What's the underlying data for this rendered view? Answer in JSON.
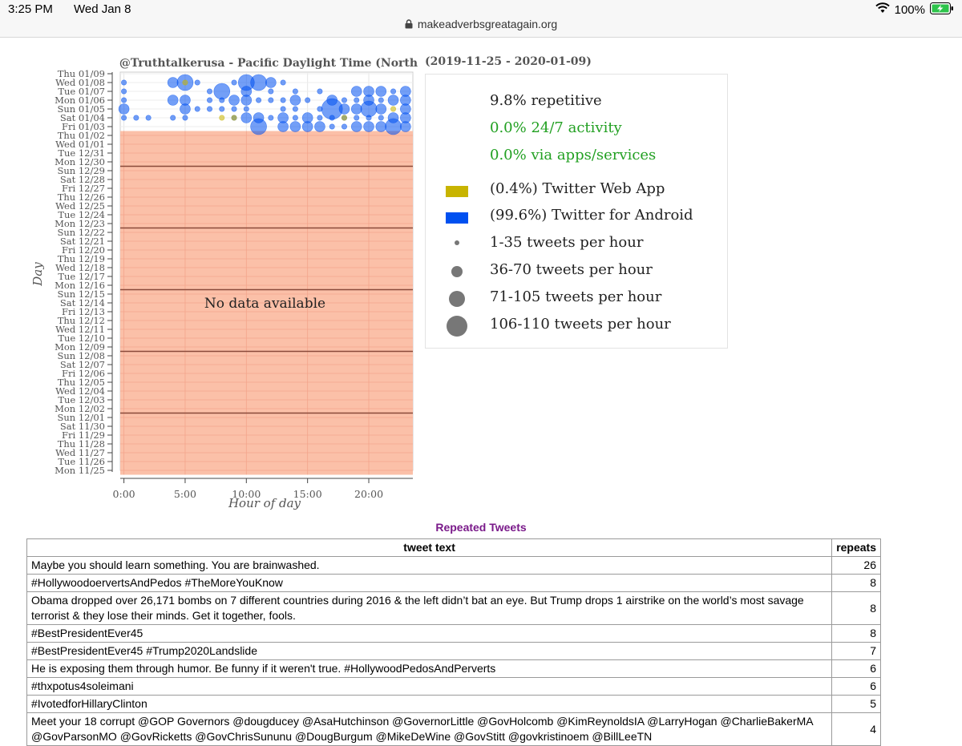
{
  "status_bar": {
    "time": "3:25 PM",
    "day": "Wed Jan 8",
    "battery": "100%",
    "url": "makeadverbsgreatagain.org"
  },
  "colors": {
    "no_data": "#fbc0a8",
    "android": "#0050f0",
    "web_app": "#c8b400",
    "green_text": "#22a022",
    "title_purple": "#7a1a8a"
  },
  "chart_data": {
    "type": "scatter",
    "title": "@Truthtalkerusa - Pacific Daylight Time (North",
    "subtitle": "(2019-11-25 - 2020-01-09)",
    "xlabel": "Hour of day",
    "ylabel": "Day",
    "x_ticks": [
      "0:00",
      "5:00",
      "10:00",
      "15:00",
      "20:00"
    ],
    "x_tick_values": [
      0,
      5,
      10,
      15,
      20
    ],
    "xlim": [
      -0.3,
      23.6
    ],
    "no_data_label": "No data available",
    "no_data_days": [
      "Mon 11/25",
      "Thu 01/02"
    ],
    "y_categories": [
      "Thu 01/09",
      "Wed 01/08",
      "Tue 01/07",
      "Mon 01/06",
      "Sun 01/05",
      "Sat 01/04",
      "Fri 01/03",
      "Thu 01/02",
      "Wed 01/01",
      "Tue 12/31",
      "Mon 12/30",
      "Sun 12/29",
      "Sat 12/28",
      "Fri 12/27",
      "Thu 12/26",
      "Wed 12/25",
      "Tue 12/24",
      "Mon 12/23",
      "Sun 12/22",
      "Sat 12/21",
      "Fri 12/20",
      "Thu 12/19",
      "Wed 12/18",
      "Tue 12/17",
      "Mon 12/16",
      "Sun 12/15",
      "Sat 12/14",
      "Fri 12/13",
      "Thu 12/12",
      "Wed 12/11",
      "Tue 12/10",
      "Mon 12/09",
      "Sun 12/08",
      "Sat 12/07",
      "Fri 12/06",
      "Thu 12/05",
      "Wed 12/04",
      "Tue 12/03",
      "Mon 12/02",
      "Sun 12/01",
      "Sat 11/30",
      "Fri 11/29",
      "Thu 11/28",
      "Wed 11/27",
      "Tue 11/26",
      "Mon 11/25"
    ],
    "week_lines": [
      "Mon 12/30",
      "Mon 12/23",
      "Mon 12/16",
      "Mon 12/09",
      "Mon 12/02"
    ],
    "series": [
      {
        "name": "Twitter for Android",
        "color": "#0050f0",
        "points": [
          {
            "day": "Wed 01/08",
            "hour": 0,
            "size": 1
          },
          {
            "day": "Tue 01/07",
            "hour": 0,
            "size": 1
          },
          {
            "day": "Mon 01/06",
            "hour": 0,
            "size": 1
          },
          {
            "day": "Sun 01/05",
            "hour": 0,
            "size": 2
          },
          {
            "day": "Sat 01/04",
            "hour": 0,
            "size": 1
          },
          {
            "day": "Sat 01/04",
            "hour": 1,
            "size": 1
          },
          {
            "day": "Sat 01/04",
            "hour": 2,
            "size": 1
          },
          {
            "day": "Wed 01/08",
            "hour": 4,
            "size": 2
          },
          {
            "day": "Mon 01/06",
            "hour": 4,
            "size": 2
          },
          {
            "day": "Sat 01/04",
            "hour": 4,
            "size": 1
          },
          {
            "day": "Wed 01/08",
            "hour": 5,
            "size": 3
          },
          {
            "day": "Mon 01/06",
            "hour": 5,
            "size": 2
          },
          {
            "day": "Sun 01/05",
            "hour": 5,
            "size": 2
          },
          {
            "day": "Sat 01/04",
            "hour": 5,
            "size": 1
          },
          {
            "day": "Wed 01/08",
            "hour": 6,
            "size": 1
          },
          {
            "day": "Sun 01/05",
            "hour": 6,
            "size": 1
          },
          {
            "day": "Tue 01/07",
            "hour": 7,
            "size": 1
          },
          {
            "day": "Mon 01/06",
            "hour": 7,
            "size": 1
          },
          {
            "day": "Sun 01/05",
            "hour": 7,
            "size": 1
          },
          {
            "day": "Tue 01/07",
            "hour": 8,
            "size": 3
          },
          {
            "day": "Mon 01/06",
            "hour": 8,
            "size": 1
          },
          {
            "day": "Sun 01/05",
            "hour": 8,
            "size": 1
          },
          {
            "day": "Wed 01/08",
            "hour": 9,
            "size": 1
          },
          {
            "day": "Mon 01/06",
            "hour": 9,
            "size": 2
          },
          {
            "day": "Sun 01/05",
            "hour": 9,
            "size": 1
          },
          {
            "day": "Sat 01/04",
            "hour": 9,
            "size": 1
          },
          {
            "day": "Wed 01/08",
            "hour": 10,
            "size": 3
          },
          {
            "day": "Tue 01/07",
            "hour": 10,
            "size": 2
          },
          {
            "day": "Mon 01/06",
            "hour": 10,
            "size": 2
          },
          {
            "day": "Sun 01/05",
            "hour": 10,
            "size": 1
          },
          {
            "day": "Sat 01/04",
            "hour": 10,
            "size": 2
          },
          {
            "day": "Wed 01/08",
            "hour": 11,
            "size": 3
          },
          {
            "day": "Mon 01/06",
            "hour": 11,
            "size": 1
          },
          {
            "day": "Sat 01/04",
            "hour": 11,
            "size": 2
          },
          {
            "day": "Fri 01/03",
            "hour": 11,
            "size": 3
          },
          {
            "day": "Wed 01/08",
            "hour": 12,
            "size": 2
          },
          {
            "day": "Tue 01/07",
            "hour": 12,
            "size": 1
          },
          {
            "day": "Mon 01/06",
            "hour": 12,
            "size": 1
          },
          {
            "day": "Sat 01/04",
            "hour": 12,
            "size": 1
          },
          {
            "day": "Wed 01/08",
            "hour": 13,
            "size": 1
          },
          {
            "day": "Mon 01/06",
            "hour": 13,
            "size": 1
          },
          {
            "day": "Sun 01/05",
            "hour": 13,
            "size": 1
          },
          {
            "day": "Sat 01/04",
            "hour": 13,
            "size": 2
          },
          {
            "day": "Fri 01/03",
            "hour": 13,
            "size": 2
          },
          {
            "day": "Tue 01/07",
            "hour": 14,
            "size": 1
          },
          {
            "day": "Mon 01/06",
            "hour": 14,
            "size": 2
          },
          {
            "day": "Sun 01/05",
            "hour": 14,
            "size": 1
          },
          {
            "day": "Sat 01/04",
            "hour": 14,
            "size": 1
          },
          {
            "day": "Fri 01/03",
            "hour": 14,
            "size": 2
          },
          {
            "day": "Mon 01/06",
            "hour": 15,
            "size": 1
          },
          {
            "day": "Sat 01/04",
            "hour": 15,
            "size": 2
          },
          {
            "day": "Fri 01/03",
            "hour": 15,
            "size": 2
          },
          {
            "day": "Tue 01/07",
            "hour": 16,
            "size": 1
          },
          {
            "day": "Sun 01/05",
            "hour": 16,
            "size": 1
          },
          {
            "day": "Sat 01/04",
            "hour": 16,
            "size": 1
          },
          {
            "day": "Fri 01/03",
            "hour": 16,
            "size": 2
          },
          {
            "day": "Mon 01/06",
            "hour": 17,
            "size": 2
          },
          {
            "day": "Sun 01/05",
            "hour": 17,
            "size": 4
          },
          {
            "day": "Sat 01/04",
            "hour": 17,
            "size": 1
          },
          {
            "day": "Fri 01/03",
            "hour": 17,
            "size": 1
          },
          {
            "day": "Mon 01/06",
            "hour": 18,
            "size": 1
          },
          {
            "day": "Sun 01/05",
            "hour": 18,
            "size": 2
          },
          {
            "day": "Sat 01/04",
            "hour": 18,
            "size": 1
          },
          {
            "day": "Fri 01/03",
            "hour": 18,
            "size": 1
          },
          {
            "day": "Tue 01/07",
            "hour": 19,
            "size": 2
          },
          {
            "day": "Mon 01/06",
            "hour": 19,
            "size": 1
          },
          {
            "day": "Sun 01/05",
            "hour": 19,
            "size": 2
          },
          {
            "day": "Sat 01/04",
            "hour": 19,
            "size": 1
          },
          {
            "day": "Fri 01/03",
            "hour": 19,
            "size": 2
          },
          {
            "day": "Tue 01/07",
            "hour": 20,
            "size": 2
          },
          {
            "day": "Mon 01/06",
            "hour": 20,
            "size": 2
          },
          {
            "day": "Sun 01/05",
            "hour": 20,
            "size": 3
          },
          {
            "day": "Sat 01/04",
            "hour": 20,
            "size": 1
          },
          {
            "day": "Fri 01/03",
            "hour": 20,
            "size": 2
          },
          {
            "day": "Tue 01/07",
            "hour": 21,
            "size": 2
          },
          {
            "day": "Mon 01/06",
            "hour": 21,
            "size": 1
          },
          {
            "day": "Sun 01/05",
            "hour": 21,
            "size": 2
          },
          {
            "day": "Sat 01/04",
            "hour": 21,
            "size": 1
          },
          {
            "day": "Fri 01/03",
            "hour": 21,
            "size": 2
          },
          {
            "day": "Tue 01/07",
            "hour": 22,
            "size": 1
          },
          {
            "day": "Mon 01/06",
            "hour": 22,
            "size": 2
          },
          {
            "day": "Sat 01/04",
            "hour": 22,
            "size": 2
          },
          {
            "day": "Fri 01/03",
            "hour": 22,
            "size": 3
          },
          {
            "day": "Tue 01/07",
            "hour": 23,
            "size": 2
          },
          {
            "day": "Mon 01/06",
            "hour": 23,
            "size": 2
          },
          {
            "day": "Sun 01/05",
            "hour": 23,
            "size": 2
          },
          {
            "day": "Sat 01/04",
            "hour": 23,
            "size": 2
          },
          {
            "day": "Fri 01/03",
            "hour": 23,
            "size": 2
          }
        ]
      },
      {
        "name": "Twitter Web App",
        "color": "#c8b400",
        "points": [
          {
            "day": "Wed 01/08",
            "hour": 5,
            "size": 1
          },
          {
            "day": "Sat 01/04",
            "hour": 8,
            "size": 1
          },
          {
            "day": "Sat 01/04",
            "hour": 9,
            "size": 1
          },
          {
            "day": "Sat 01/04",
            "hour": 18,
            "size": 1
          },
          {
            "day": "Sun 01/05",
            "hour": 22,
            "size": 1
          }
        ]
      }
    ]
  },
  "legend": {
    "repetitive": "9.8% repetitive",
    "activity": "0.0% 24/7 activity",
    "apps": "0.0% via apps/services",
    "web_app": "(0.4%) Twitter Web App",
    "android": "(99.6%) Twitter for Android",
    "size_1": "1-35 tweets per hour",
    "size_2": "36-70 tweets per hour",
    "size_3": "71-105 tweets per hour",
    "size_4": "106-110 tweets per hour"
  },
  "repeated_tweets": {
    "title": "Repeated Tweets",
    "col_text": "tweet text",
    "col_repeats": "repeats",
    "rows": [
      {
        "text": "Maybe you should learn something. You are brainwashed.",
        "repeats": "26"
      },
      {
        "text": "#HollywoodoervertsAndPedos #TheMoreYouKnow",
        "repeats": "8"
      },
      {
        "text": "Obama dropped over 26,171 bombs on 7 different countries during 2016 & the left didn’t bat an eye. But Trump drops 1 airstrike on the world’s most savage terrorist & they lose their minds. Get it together, fools.",
        "repeats": "8"
      },
      {
        "text": "#BestPresidentEver45",
        "repeats": "8"
      },
      {
        "text": "#BestPresidentEver45 #Trump2020Landslide",
        "repeats": "7"
      },
      {
        "text": "He is exposing them through humor. Be funny if it weren't true. #HollywoodPedosAndPerverts",
        "repeats": "6"
      },
      {
        "text": "#thxpotus4soleimani",
        "repeats": "6"
      },
      {
        "text": "#IvotedforHillaryClinton",
        "repeats": "5"
      },
      {
        "text": "Meet your 18 corrupt @GOP Governors @dougducey @AsaHutchinson @GovernorLittle @GovHolcomb @KimReynoldsIA @LarryHogan @CharlieBakerMA @GovParsonMO @GovRicketts @GovChrisSununu @DougBurgum @MikeDeWine @GovStitt @govkristinoem @BillLeeTN",
        "repeats": "4"
      }
    ]
  }
}
